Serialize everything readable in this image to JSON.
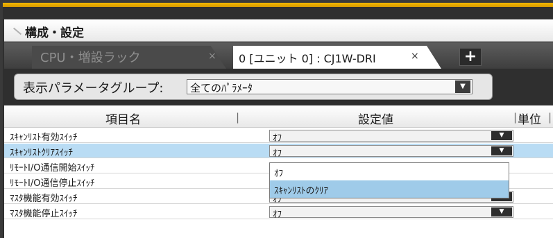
{
  "title": "構成・設定",
  "tabs": [
    {
      "label": "CPU・増設ラック",
      "close": "×",
      "active": false
    },
    {
      "label": "0 [ユニット 0] : CJ1W-DRI",
      "close": "×",
      "active": true
    }
  ],
  "add_tab": "+",
  "group": {
    "label": "表示パラメータグループ:",
    "value": "全てのﾊﾟﾗﾒｰﾀ",
    "arrow": "▼"
  },
  "columns": {
    "item": "項目名",
    "setting": "設定値",
    "unit": "単位",
    "sep": "|"
  },
  "rows": [
    {
      "name": "ｽｷｬﾝﾘｽﾄ有効ｽｲｯﾁ",
      "value": "ｵﾌ",
      "arrow": "▼"
    },
    {
      "name": "ｽｷｬﾝﾘｽﾄｸﾘｱｽｲｯﾁ",
      "value": "ｵﾌ",
      "arrow": "▼"
    },
    {
      "name": "ﾘﾓｰﾄI/O通信開始ｽｲｯﾁ",
      "value": "",
      "arrow": ""
    },
    {
      "name": "ﾘﾓｰﾄI/O通信停止ｽｲｯﾁ",
      "value": "",
      "arrow": ""
    },
    {
      "name": "ﾏｽﾀ機能有効ｽｲｯﾁ",
      "value": "ｵﾌ",
      "arrow": "▼"
    },
    {
      "name": "ﾏｽﾀ機能停止ｽｲｯﾁ",
      "value": "ｵﾌ",
      "arrow": "▼"
    }
  ],
  "dropdown": {
    "options": [
      "ｵﾌ",
      "ｽｷｬﾝﾘｽﾄのｸﾘｱ"
    ],
    "highlighted": 1
  }
}
